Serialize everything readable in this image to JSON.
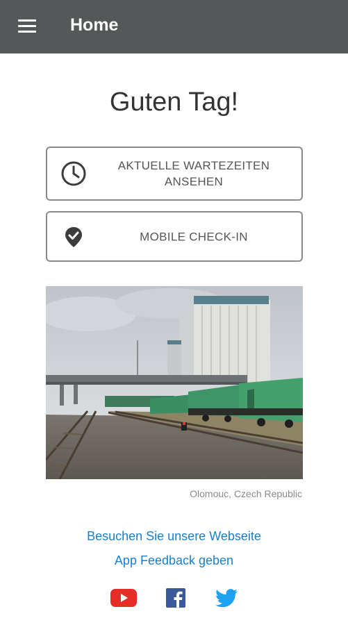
{
  "appbar": {
    "title": "Home",
    "menu_icon": "hamburger-menu-icon",
    "background": "#545859"
  },
  "greeting": "Guten Tag!",
  "buttons": {
    "wait_times": {
      "label": "AKTUELLE WARTEZEITEN ANSEHEN",
      "icon": "clock-icon"
    },
    "checkin": {
      "label": "MOBILE CHECK-IN",
      "icon": "location-check-icon"
    }
  },
  "photo": {
    "caption": "Olomouc, Czech Republic"
  },
  "links": {
    "website": "Besuchen Sie unsere Webseite",
    "feedback": "App Feedback geben"
  },
  "social": [
    {
      "name": "youtube-icon",
      "color": "#e52d27"
    },
    {
      "name": "facebook-icon",
      "color": "#3b5998"
    },
    {
      "name": "twitter-icon",
      "color": "#1da1f2"
    }
  ],
  "colors": {
    "link": "#1a7fc9",
    "button_border": "#8a8a8a",
    "text_dark": "#333333"
  }
}
